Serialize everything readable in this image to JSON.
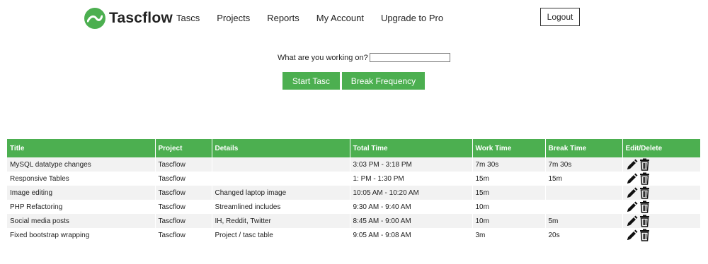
{
  "nav": {
    "logo_text": "Tascflow",
    "links": [
      "Tascs",
      "Projects",
      "Reports",
      "My Account",
      "Upgrade to Pro"
    ],
    "logout_label": "Logout"
  },
  "form": {
    "prompt": "What are you working on?",
    "input_value": "",
    "start_label": "Start Tasc",
    "break_label": "Break Frequency"
  },
  "table": {
    "headers": [
      "Title",
      "Project",
      "Details",
      "Total Time",
      "Work Time",
      "Break Time",
      "Edit/Delete"
    ],
    "rows": [
      [
        "MySQL datatype changes",
        "Tascflow",
        "",
        "3:03 PM - 3:18 PM",
        "7m 30s",
        "7m 30s"
      ],
      [
        "Responsive Tables",
        "Tascflow",
        "",
        "1: PM - 1:30 PM",
        "15m",
        "15m"
      ],
      [
        "Image editing",
        "Tascflow",
        "Changed laptop image",
        "10:05 AM - 10:20 AM",
        "15m",
        ""
      ],
      [
        "PHP Refactoring",
        "Tascflow",
        "Streamlined includes",
        "9:30 AM - 9:40 AM",
        "10m",
        ""
      ],
      [
        "Social media posts",
        "Tascflow",
        "IH, Reddit, Twitter",
        "8:45 AM - 9:00 AM",
        "10m",
        "5m"
      ],
      [
        "Fixed bootstrap wrapping",
        "Tascflow",
        "Project / tasc table",
        "9:05 AM - 9:08 AM",
        "3m",
        "20s"
      ]
    ]
  },
  "colors": {
    "accent": "#4caf50",
    "row_stripe": "#f2f2f2"
  },
  "icons": {
    "edit": "pencil-icon",
    "delete": "trash-icon"
  }
}
